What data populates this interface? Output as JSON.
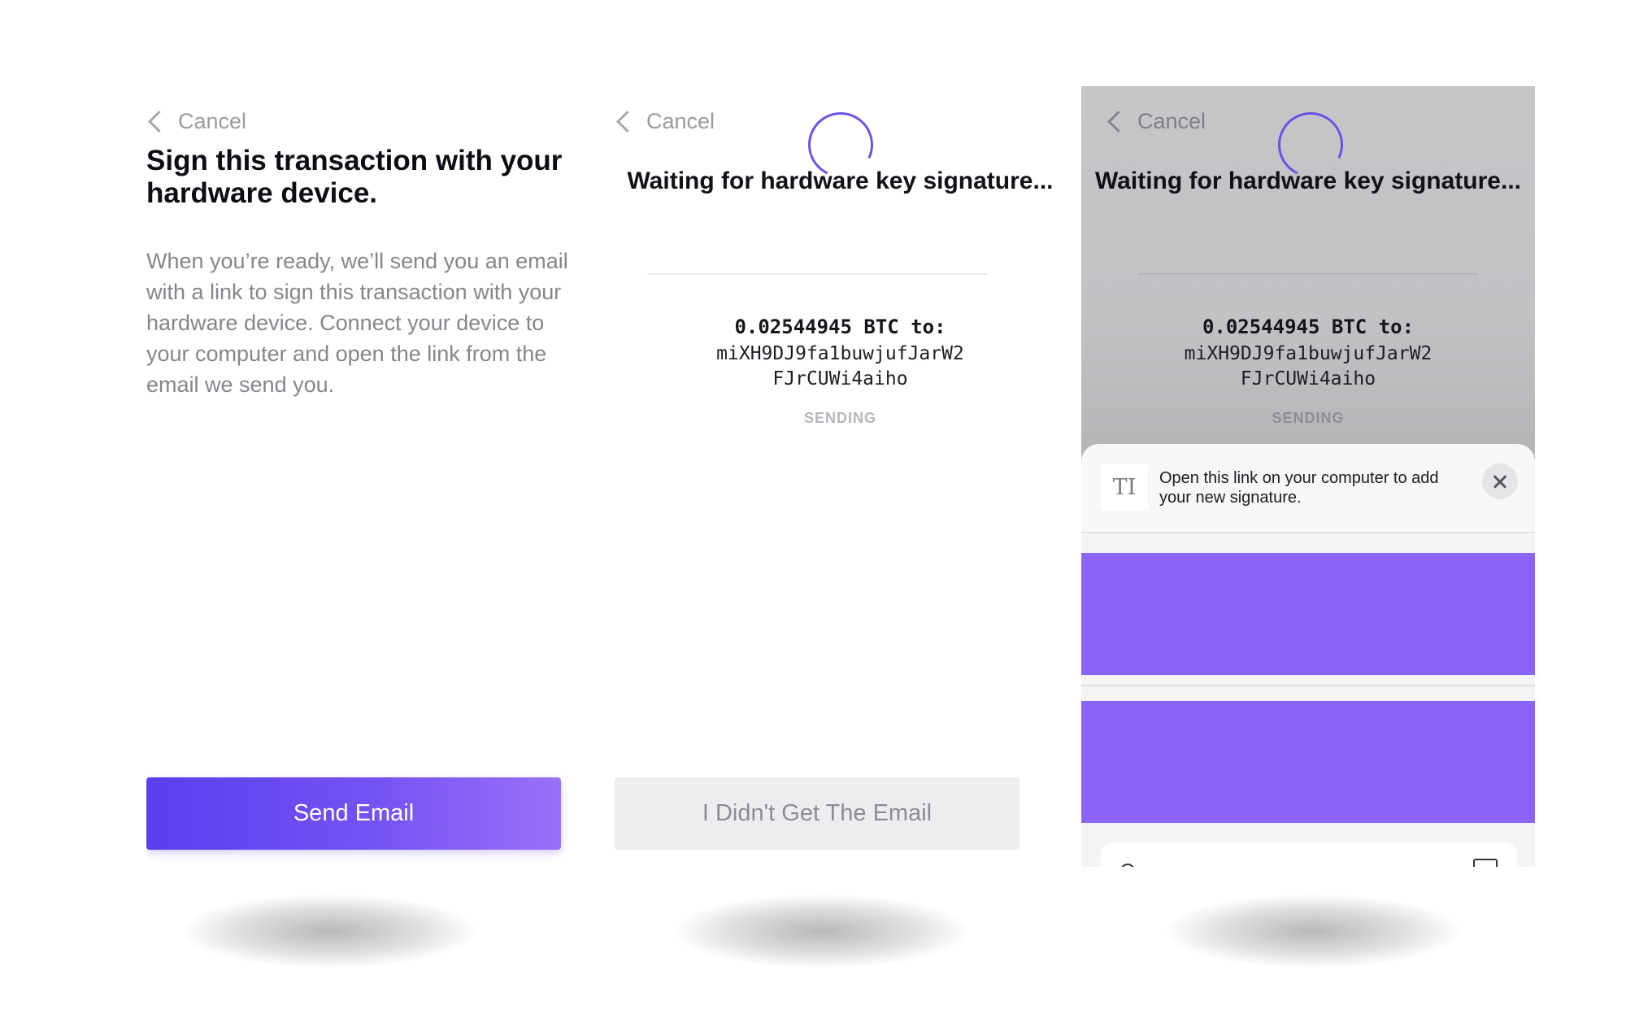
{
  "common": {
    "cancel_label": "Cancel"
  },
  "screen1": {
    "title": "Sign this transaction with your hardware device.",
    "description": "When you’re ready, we’ll send you an email with a link to sign this transaction with your hardware device. Connect your device to your computer and open the link from the email we send you.",
    "button_label": "Send Email"
  },
  "screen2": {
    "title": "Waiting for hardware key signature...",
    "amount": "0.02544945 BTC to:",
    "address_line1": "miXH9DJ9fa1buwjufJarW2",
    "address_line2": "FJrCUWi4aiho",
    "status": "SENDING",
    "button_label": "I Didn't Get The Email"
  },
  "screen3": {
    "title": "Waiting for hardware key signature...",
    "amount": "0.02544945 BTC to:",
    "address_line1": "miXH9DJ9fa1buwjufJarW2",
    "address_line2": "FJrCUWi4aiho",
    "status": "SENDING",
    "share_message": "Open this link on your computer to add your new signature.",
    "share_icon_glyph": "TI"
  },
  "colors": {
    "accent": "#6b52e8",
    "button_gradient_start": "#5a3ff0",
    "button_gradient_end": "#9a70f8",
    "purple_block": "#8c65f8"
  }
}
